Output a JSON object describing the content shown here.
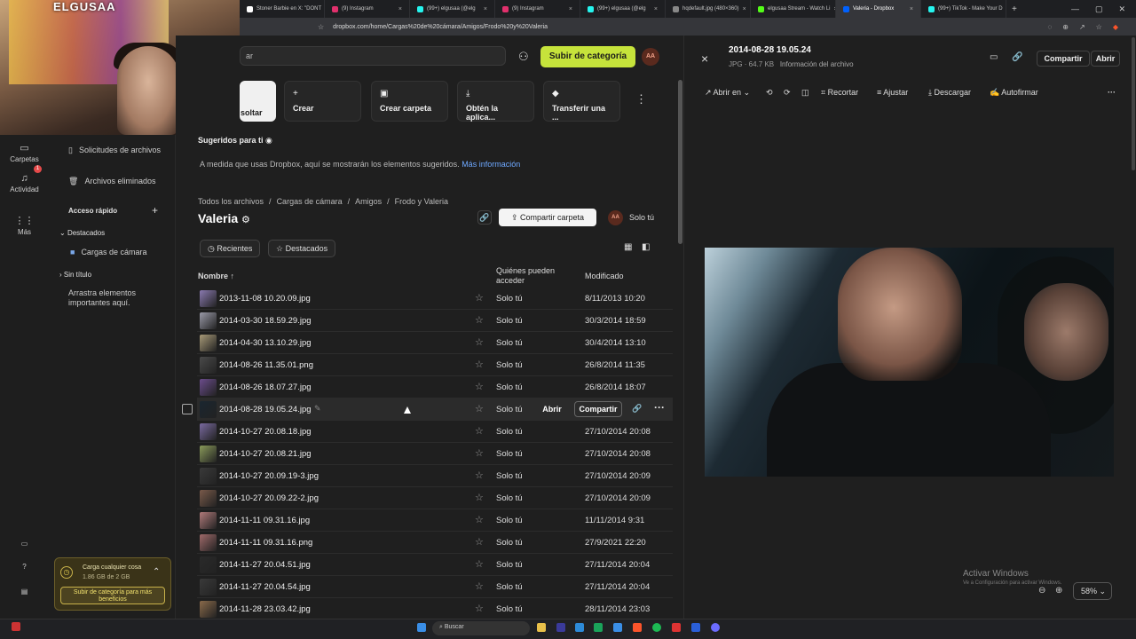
{
  "browser": {
    "tabs": [
      {
        "label": "Stoner Barbie en X: \"DONT",
        "color": "#ffffff"
      },
      {
        "label": "(9) Instagram",
        "color": "#e1306c"
      },
      {
        "label": "(99+) elgusaa (@elg",
        "color": "#25f4ee"
      },
      {
        "label": "(9) Instagram",
        "color": "#e1306c"
      },
      {
        "label": "(99+) elgusaa (@elg",
        "color": "#25f4ee"
      },
      {
        "label": "hqdefault.jpg (480×360)",
        "color": "#888888"
      },
      {
        "label": "elgusaa Stream - Watch Li",
        "color": "#53fc18"
      },
      {
        "label": "Valeria - Dropbox",
        "color": "#0061fe"
      },
      {
        "label": "(99+) TikTok - Make Your D",
        "color": "#25f4ee"
      }
    ],
    "url": "dropbox.com/home/Cargas%20de%20cámara/Amigos/Frodo%20y%20Valeria"
  },
  "webcam": {
    "poster_text": "ELGUSAA"
  },
  "rail": {
    "items": [
      {
        "label": "Carpetas",
        "icon": "folder-icon"
      },
      {
        "label": "Actividad",
        "icon": "bell-icon"
      },
      {
        "label": "Más",
        "icon": "grid-icon"
      }
    ],
    "badge": "1"
  },
  "sidebar": {
    "requests": "Solicitudes de archivos",
    "deleted": "Archivos eliminados",
    "quick_access": "Acceso rápido",
    "starred_section": "Destacados",
    "starred_item": "Cargas de cámara",
    "untitled_section": "Sin título",
    "drag_hint": "Arrastra elementos importantes aquí.",
    "storage_title": "Carga cualquier cosa",
    "storage_used": "1.86 GB de 2 GB",
    "upgrade_label": "Subir de categoría para más beneficios"
  },
  "header": {
    "search_placeholder": "ar",
    "upgrade_button": "Subir de categoría",
    "avatar": "AA"
  },
  "actions": [
    {
      "label": "soltar",
      "icon": ""
    },
    {
      "label": "Crear",
      "icon": "+"
    },
    {
      "label": "Crear carpeta",
      "icon": "▣"
    },
    {
      "label": "Obtén la aplica...",
      "icon": "⤓"
    },
    {
      "label": "Transferir una ...",
      "icon": "◆"
    }
  ],
  "suggested": {
    "title": "Sugeridos para ti",
    "text": "A medida que usas Dropbox, aquí se mostrarán los elementos sugeridos.",
    "link": "Más información"
  },
  "breadcrumb": [
    "Todos los archivos",
    "Cargas de cámara",
    "Amigos",
    "Frodo y Valeria"
  ],
  "folder": {
    "title": "Valeria",
    "share_button": "Compartir carpeta",
    "owner": "Solo tú"
  },
  "filters": {
    "recent": "Recientes",
    "starred": "Destacados"
  },
  "table": {
    "col_name": "Nombre",
    "col_access": "Quiénes pueden acceder",
    "col_modified": "Modificado",
    "row_open": "Abrir",
    "row_share": "Compartir",
    "rows": [
      {
        "name": "2013-11-08 10.20.09.jpg",
        "access": "Solo tú",
        "modified": "8/11/2013 10:20",
        "thumb": "#8a7ab0"
      },
      {
        "name": "2014-03-30 18.59.29.jpg",
        "access": "Solo tú",
        "modified": "30/3/2014 18:59",
        "thumb": "#9a9aa8"
      },
      {
        "name": "2014-04-30 13.10.29.jpg",
        "access": "Solo tú",
        "modified": "30/4/2014 13:10",
        "thumb": "#a89a78"
      },
      {
        "name": "2014-08-26 11.35.01.png",
        "access": "Solo tú",
        "modified": "26/8/2014 11:35",
        "thumb": "#4a4a4a"
      },
      {
        "name": "2014-08-26 18.07.27.jpg",
        "access": "Solo tú",
        "modified": "26/8/2014 18:07",
        "thumb": "#6b4c8c"
      },
      {
        "name": "2014-08-28 19.05.24.jpg",
        "access": "Solo tú",
        "modified": "",
        "thumb": "#1a2630"
      },
      {
        "name": "2014-10-27 20.08.18.jpg",
        "access": "Solo tú",
        "modified": "27/10/2014 20:08",
        "thumb": "#7a6aa0"
      },
      {
        "name": "2014-10-27 20.08.21.jpg",
        "access": "Solo tú",
        "modified": "27/10/2014 20:08",
        "thumb": "#8a9a5a"
      },
      {
        "name": "2014-10-27 20.09.19-3.jpg",
        "access": "Solo tú",
        "modified": "27/10/2014 20:09",
        "thumb": "#3a3a3a"
      },
      {
        "name": "2014-10-27 20.09.22-2.jpg",
        "access": "Solo tú",
        "modified": "27/10/2014 20:09",
        "thumb": "#7a5a4a"
      },
      {
        "name": "2014-11-11 09.31.16.jpg",
        "access": "Solo tú",
        "modified": "11/11/2014 9:31",
        "thumb": "#b07a7a"
      },
      {
        "name": "2014-11-11 09.31.16.png",
        "access": "Solo tú",
        "modified": "27/9/2021 22:20",
        "thumb": "#a06a6a"
      },
      {
        "name": "2014-11-27 20.04.51.jpg",
        "access": "Solo tú",
        "modified": "27/11/2014 20:04",
        "thumb": "#2a2a2a"
      },
      {
        "name": "2014-11-27 20.04.54.jpg",
        "access": "Solo tú",
        "modified": "27/11/2014 20:04",
        "thumb": "#3a3a3a"
      },
      {
        "name": "2014-11-28 23.03.42.jpg",
        "access": "Solo tú",
        "modified": "28/11/2014 23:03",
        "thumb": "#8a6a4a"
      }
    ]
  },
  "preview": {
    "title": "2014-08-28 19.05.24",
    "meta": "JPG · 64.7 KB",
    "info_link": "Información del archivo",
    "share": "Compartir",
    "open": "Abrir",
    "tools": {
      "open_in": "Abrir en",
      "crop": "Recortar",
      "adjust": "Ajustar",
      "download": "Descargar",
      "autosign": "Autofirmar"
    },
    "zoom": "58%"
  },
  "windows": {
    "activate_title": "Activar Windows",
    "activate_sub": "Ve a Configuración para activar Windows.",
    "search": "Buscar"
  }
}
